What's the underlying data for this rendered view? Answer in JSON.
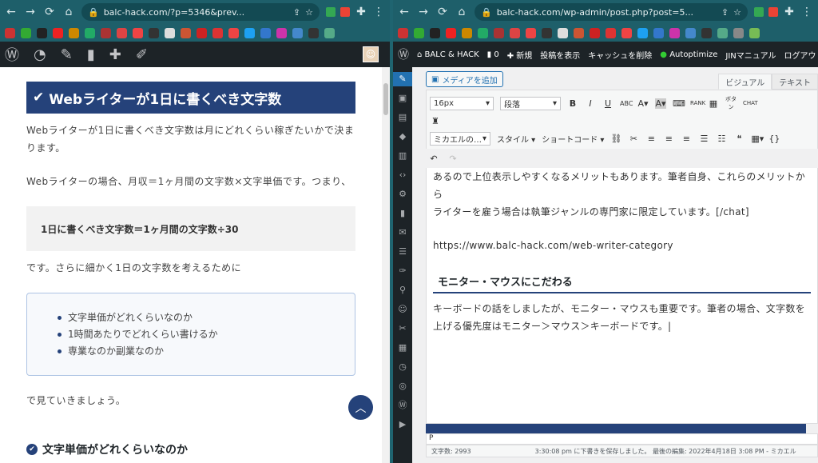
{
  "left_window": {
    "url": "balc-hack.com/?p=5346&prev...",
    "article": {
      "heading": "Webライターが1日に書くべき文字数",
      "para1": "Webライターが1日に書くべき文字数は月にどれくらい稼ぎたいかで決まります。",
      "para2": "Webライターの場合、月収＝1ヶ月間の文字数×文字単価です。つまり、",
      "formula": "1日に書くべき文字数＝1ヶ月間の文字数÷30",
      "para3": "です。さらに細かく1日の文字数を考えるために",
      "list": [
        "文字単価がどれくらいなのか",
        "1時間あたりでどれくらい書けるか",
        "専業なのか副業なのか"
      ],
      "para4": "で見ていきましょう。",
      "subheading": "文字単価がどれくらいなのか"
    }
  },
  "right_window": {
    "url": "balc-hack.com/wp-admin/post.php?post=5...",
    "admin_bar": {
      "site": "BALC & HACK",
      "comments": "0",
      "new": "新規",
      "view": "投稿を表示",
      "cache": "キャッシュを削除",
      "autoptimize": "Autoptimize",
      "manual": "JINマニュアル",
      "logout": "ログアウト"
    },
    "editor": {
      "add_media": "メディアを追加",
      "tab_visual": "ビジュアル",
      "tab_text": "テキスト",
      "font_size": "16px",
      "format": "段落",
      "font_family": "ミカエルの…",
      "style": "スタイル",
      "shortcode": "ショートコード",
      "line1": "あるので上位表示しやすくなるメリットもあります。筆者自身、これらのメリットから",
      "line2": "ライターを雇う場合は執筆ジャンルの専門家に限定しています。[/chat]",
      "url_line": "https://www.balc-hack.com/web-writer-category",
      "heading": "モニター・マウスにこだわる",
      "body": "キーボードの話をしましたが、モニター・マウスも重要です。筆者の場合、文字数を上げる優先度はモニター＞マウス＞キーボードです。|",
      "path": "P",
      "word_count": "文字数: 2993",
      "saved": "3:30:08 pm に下書きを保存しました。 最後の編集: 2022年4月18日 3:08 PM - ミカエル"
    }
  }
}
